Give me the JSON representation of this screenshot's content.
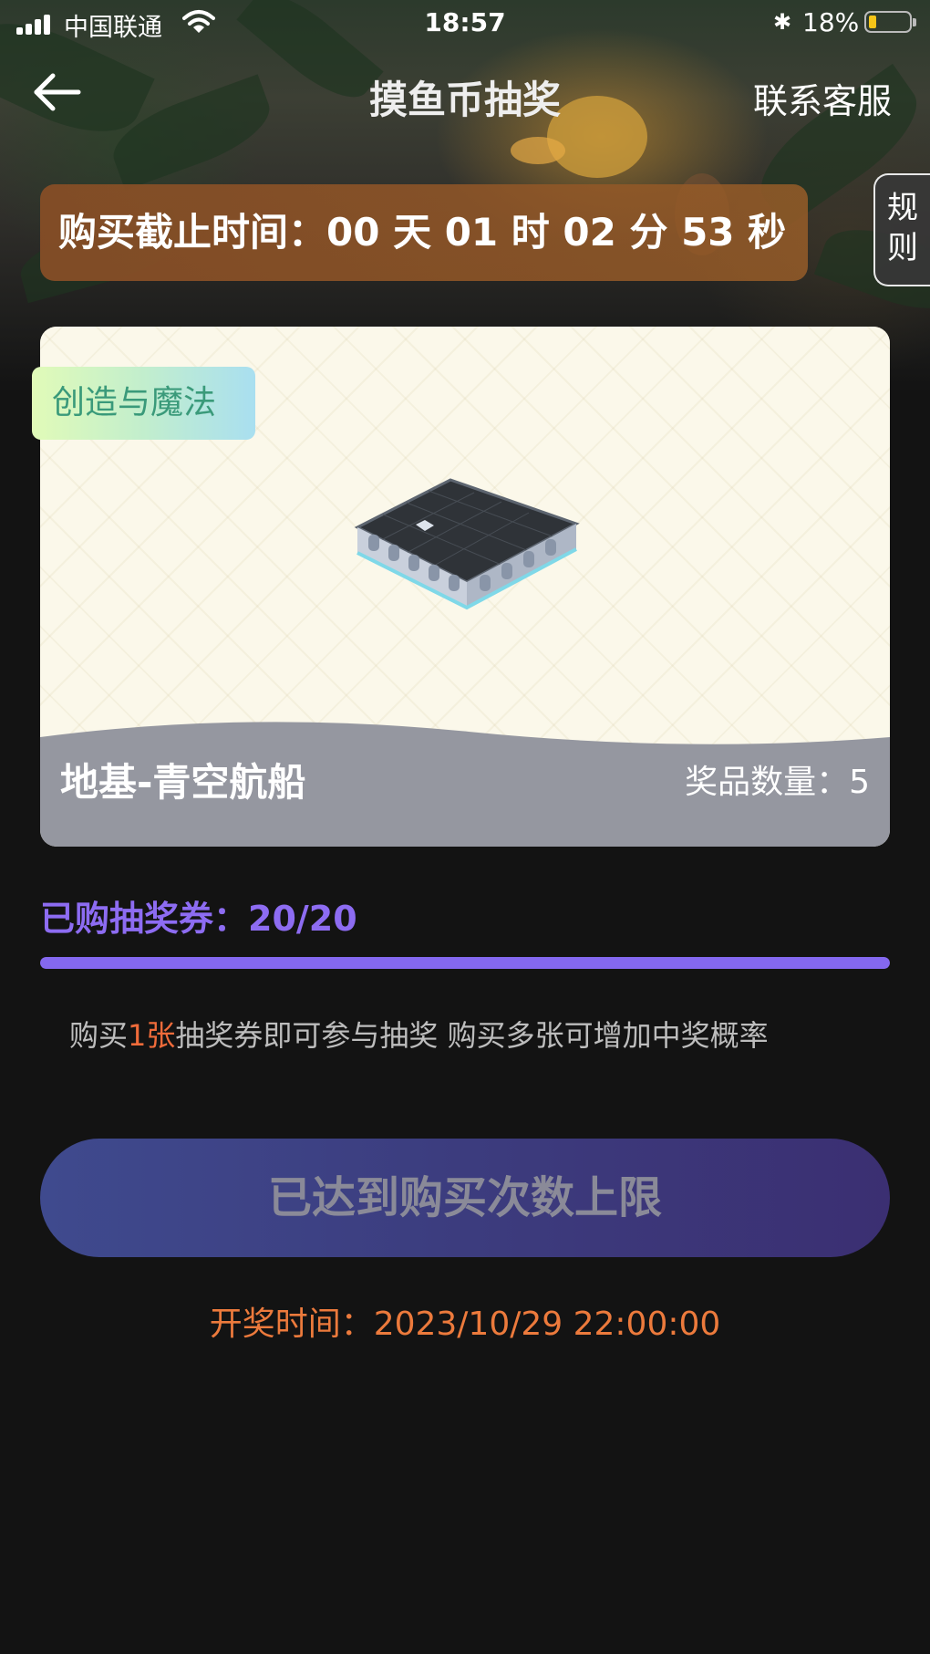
{
  "status_bar": {
    "carrier": "中国联通",
    "time": "18:57",
    "battery_percent": "18%",
    "battery_level": 0.18,
    "bluetooth_icon": "bluetooth-icon",
    "wifi_icon": "wifi-icon",
    "signal_icon": "signal-icon"
  },
  "nav": {
    "back_icon": "arrow-left-icon",
    "title": "摸鱼币抽奖",
    "service_label": "联系客服"
  },
  "countdown": {
    "text": "购买截止时间：00 天 01 时 02 分 53 秒"
  },
  "rules_tab": {
    "line1": "规",
    "line2": "则"
  },
  "prize": {
    "category_tag": "创造与魔法",
    "name": "地基-青空航船",
    "quantity_text": "奖品数量：5",
    "image_icon": "floating-platform-image"
  },
  "tickets": {
    "label": "已购抽奖券：20/20",
    "purchased": 20,
    "limit": 20,
    "progress_fraction": 1.0
  },
  "hint": {
    "before": "购买",
    "highlight": "1张",
    "after": "抽奖券即可参与抽奖 购买多张可增加中奖概率"
  },
  "buy_button": {
    "label": "已达到购买次数上限"
  },
  "draw_time": {
    "text": "开奖时间：2023/10/29 22:00:00"
  },
  "colors": {
    "accent_purple": "#8d6cf2",
    "highlight_orange": "#f06b3a",
    "draw_time_orange": "#ec7a3c",
    "background": "#131313"
  }
}
